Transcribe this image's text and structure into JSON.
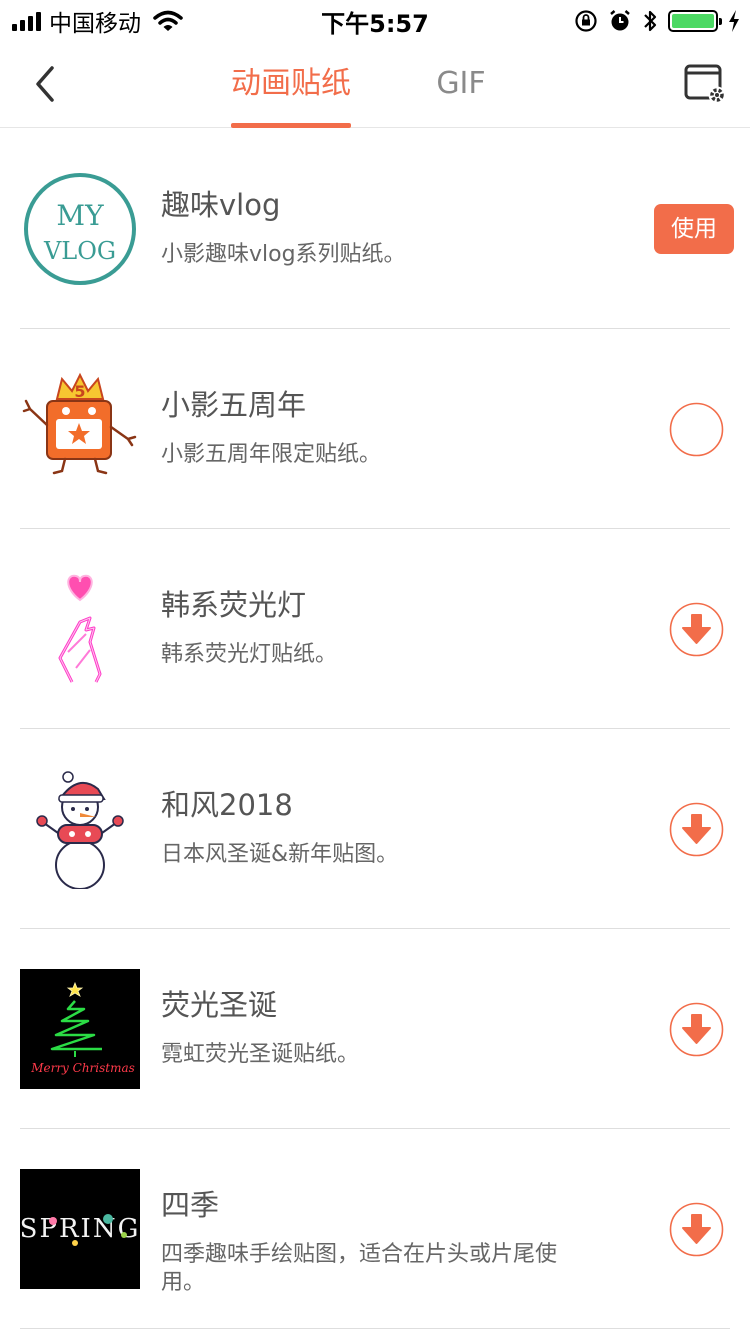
{
  "status_bar": {
    "carrier": "中国移动",
    "time": "下午5:57"
  },
  "nav": {
    "tabs": [
      {
        "label": "动画贴纸",
        "active": true
      },
      {
        "label": "GIF",
        "active": false
      }
    ]
  },
  "colors": {
    "accent": "#f26d4a",
    "battery": "#4cd964",
    "divider": "#dedede"
  },
  "stickers": [
    {
      "title": "趣味vlog",
      "desc": "小影趣味vlog系列贴纸。",
      "action": "use",
      "action_label": "使用",
      "thumb_text": [
        "MY",
        "VLOG"
      ]
    },
    {
      "title": "小影五周年",
      "desc": "小影五周年限定贴纸。",
      "action": "downloading",
      "thumb_text": [
        "5"
      ]
    },
    {
      "title": "韩系荧光灯",
      "desc": "韩系荧光灯贴纸。",
      "action": "download"
    },
    {
      "title": "和风2018",
      "desc": "日本风圣诞&新年贴图。",
      "action": "download"
    },
    {
      "title": "荧光圣诞",
      "desc": "霓虹荧光圣诞贴纸。",
      "action": "download",
      "thumb_text": [
        "Merry Christmas"
      ]
    },
    {
      "title": "四季",
      "desc": "四季趣味手绘贴图，适合在片头或片尾使用。",
      "action": "download",
      "thumb_text": [
        "SPRING"
      ]
    }
  ]
}
